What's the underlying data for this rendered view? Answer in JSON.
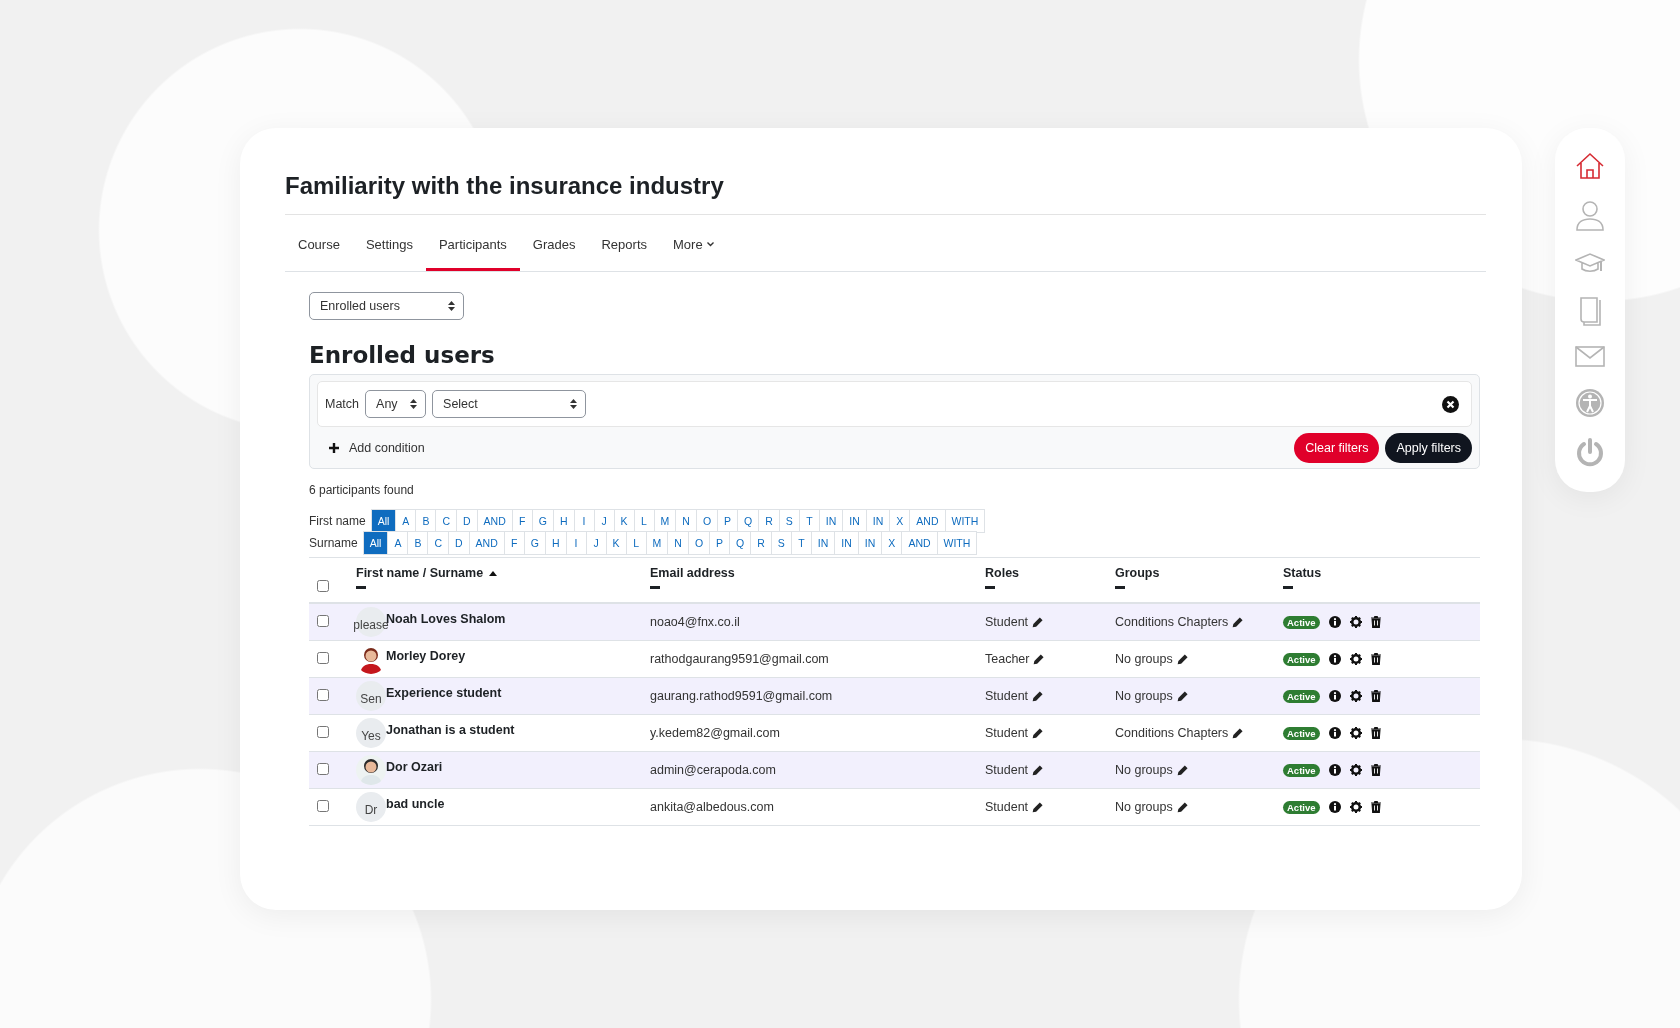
{
  "course_title": "Familiarity with the insurance industry",
  "tabs": [
    {
      "label": "Course",
      "selected": false
    },
    {
      "label": "Settings",
      "selected": false
    },
    {
      "label": "Participants",
      "selected": true
    },
    {
      "label": "Grades",
      "selected": false
    },
    {
      "label": "Reports",
      "selected": false
    },
    {
      "label": "More",
      "selected": false,
      "dropdown": true
    }
  ],
  "view_select": {
    "value": "Enrolled users"
  },
  "section_title": "Enrolled users",
  "filter": {
    "match_label": "Match",
    "match_value": "Any",
    "condition_value": "Select",
    "add_condition": "Add condition",
    "clear_button": "Clear filters",
    "apply_button": "Apply filters"
  },
  "participants_count": "6 participants found",
  "initial_bars": [
    {
      "label": "First name",
      "letters": [
        {
          "text": "All",
          "selected": true
        },
        {
          "text": "A",
          "selected": false
        },
        {
          "text": "B",
          "selected": false
        },
        {
          "text": "C",
          "selected": false
        },
        {
          "text": "D",
          "selected": false
        },
        {
          "text": "AND",
          "selected": false
        },
        {
          "text": "F",
          "selected": false
        },
        {
          "text": "G",
          "selected": false
        },
        {
          "text": "H",
          "selected": false
        },
        {
          "text": "I",
          "selected": false
        },
        {
          "text": "J",
          "selected": false
        },
        {
          "text": "K",
          "selected": false
        },
        {
          "text": "L",
          "selected": false
        },
        {
          "text": "M",
          "selected": false
        },
        {
          "text": "N",
          "selected": false
        },
        {
          "text": "O",
          "selected": false
        },
        {
          "text": "P",
          "selected": false
        },
        {
          "text": "Q",
          "selected": false
        },
        {
          "text": "R",
          "selected": false
        },
        {
          "text": "S",
          "selected": false
        },
        {
          "text": "T",
          "selected": false
        },
        {
          "text": "IN",
          "selected": false
        },
        {
          "text": "IN",
          "selected": false
        },
        {
          "text": "IN",
          "selected": false
        },
        {
          "text": "X",
          "selected": false
        },
        {
          "text": "AND",
          "selected": false
        },
        {
          "text": "WITH",
          "selected": false
        }
      ]
    },
    {
      "label": "Surname",
      "letters": [
        {
          "text": "All",
          "selected": true
        },
        {
          "text": "A",
          "selected": false
        },
        {
          "text": "B",
          "selected": false
        },
        {
          "text": "C",
          "selected": false
        },
        {
          "text": "D",
          "selected": false
        },
        {
          "text": "AND",
          "selected": false
        },
        {
          "text": "F",
          "selected": false
        },
        {
          "text": "G",
          "selected": false
        },
        {
          "text": "H",
          "selected": false
        },
        {
          "text": "I",
          "selected": false
        },
        {
          "text": "J",
          "selected": false
        },
        {
          "text": "K",
          "selected": false
        },
        {
          "text": "L",
          "selected": false
        },
        {
          "text": "M",
          "selected": false
        },
        {
          "text": "N",
          "selected": false
        },
        {
          "text": "O",
          "selected": false
        },
        {
          "text": "P",
          "selected": false
        },
        {
          "text": "Q",
          "selected": false
        },
        {
          "text": "R",
          "selected": false
        },
        {
          "text": "S",
          "selected": false
        },
        {
          "text": "T",
          "selected": false
        },
        {
          "text": "IN",
          "selected": false
        },
        {
          "text": "IN",
          "selected": false
        },
        {
          "text": "IN",
          "selected": false
        },
        {
          "text": "X",
          "selected": false
        },
        {
          "text": "AND",
          "selected": false
        },
        {
          "text": "WITH",
          "selected": false
        }
      ]
    }
  ],
  "table": {
    "select_all_checked": false,
    "columns": [
      {
        "label": "First name / Surname",
        "sorted": true
      },
      {
        "label": "Email address",
        "sorted": false
      },
      {
        "label": "Roles",
        "sorted": false
      },
      {
        "label": "Groups",
        "sorted": false
      },
      {
        "label": "Status",
        "sorted": false
      }
    ],
    "rows": [
      {
        "checked": false,
        "avatar": {
          "kind": "initials",
          "text": "please"
        },
        "name": "Noah Loves Shalom",
        "email": "noao4@fnx.co.il",
        "role": "Student",
        "groups": "Conditions Chapters",
        "status": "Active"
      },
      {
        "checked": false,
        "name": "Morley Dorey",
        "email": "rathodgaurang9591@gmail.com",
        "role": "Teacher",
        "groups": "No groups",
        "status": "Active"
      },
      {
        "checked": false,
        "avatar": {
          "kind": "initials",
          "text": "Sen"
        },
        "name": "Experience student",
        "email": "gaurang.rathod9591@gmail.com",
        "role": "Student",
        "groups": "No groups",
        "status": "Active"
      },
      {
        "checked": false,
        "avatar": {
          "kind": "initials",
          "text": "Yes"
        },
        "name": "Jonathan is a student",
        "email": "y.kedem82@gmail.com",
        "role": "Student",
        "groups": "Conditions Chapters",
        "status": "Active"
      },
      {
        "checked": false,
        "name": "Dor Ozari",
        "email": "admin@cerapoda.com",
        "role": "Student",
        "groups": "No groups",
        "status": "Active"
      },
      {
        "checked": false,
        "avatar": {
          "kind": "initials",
          "text": "Dr"
        },
        "name": "bad uncle",
        "email": "ankita@albedous.com",
        "role": "Student",
        "groups": "No groups",
        "status": "Active"
      }
    ]
  },
  "side_nav": [
    {
      "kind": "home",
      "selected": true
    },
    {
      "kind": "user",
      "selected": false
    },
    {
      "kind": "graduation",
      "selected": false
    },
    {
      "kind": "book",
      "selected": false
    },
    {
      "kind": "mail",
      "selected": false
    },
    {
      "kind": "accessibility",
      "selected": false
    },
    {
      "kind": "power",
      "selected": false
    }
  ]
}
